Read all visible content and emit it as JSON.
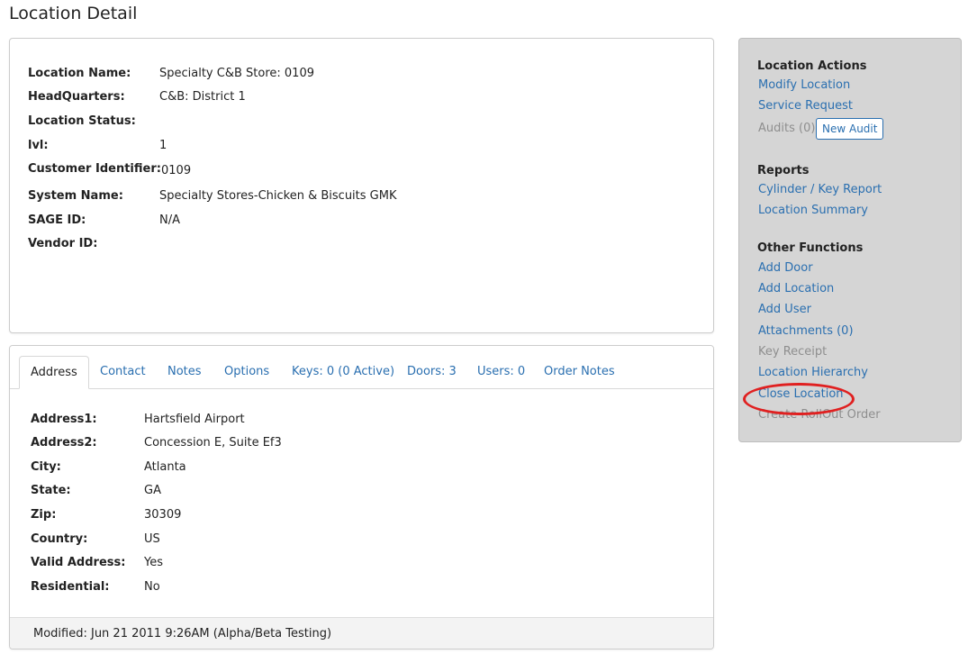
{
  "page": {
    "title": "Location Detail"
  },
  "location_info": [
    {
      "label": "Location Name:",
      "value": "Specialty C&B Store: 0109",
      "is_link": false
    },
    {
      "label": "HeadQuarters:",
      "value": "C&B: District 1",
      "is_link": true
    },
    {
      "label": "Location Status:",
      "value": "",
      "is_link": false
    },
    {
      "label": "lvl:",
      "value": "1",
      "is_link": false
    },
    {
      "label": "Customer Identifier:",
      "value": "0109",
      "is_link": false
    },
    {
      "label": "System Name:",
      "value": "Specialty Stores-Chicken & Biscuits GMK",
      "is_link": false
    },
    {
      "label": "SAGE ID:",
      "value": "N/A",
      "is_link": false
    },
    {
      "label": "Vendor ID:",
      "value": "",
      "is_link": false
    }
  ],
  "tabs": [
    {
      "label": "Address",
      "active": true
    },
    {
      "label": "Contact",
      "active": false
    },
    {
      "label": "Notes",
      "active": false
    },
    {
      "label": "Options",
      "active": false
    },
    {
      "label": "Keys: 0 (0 Active)",
      "active": false
    },
    {
      "label": "Doors: 3",
      "active": false
    },
    {
      "label": "Users: 0",
      "active": false
    },
    {
      "label": "Order Notes",
      "active": false
    }
  ],
  "address": [
    {
      "label": "Address1:",
      "value": "Hartsfield Airport"
    },
    {
      "label": "Address2:",
      "value": "Concession E, Suite Ef3"
    },
    {
      "label": "City:",
      "value": "Atlanta"
    },
    {
      "label": "State:",
      "value": "GA"
    },
    {
      "label": "Zip:",
      "value": "30309"
    },
    {
      "label": "Country:",
      "value": "US"
    },
    {
      "label": "Valid Address:",
      "value": "Yes"
    },
    {
      "label": "Residential:",
      "value": "No"
    }
  ],
  "footer": {
    "modified": "Modified: Jun 21 2011 9:26AM (Alpha/Beta Testing)"
  },
  "actions_panel": {
    "location_actions": {
      "heading": "Location Actions",
      "modify": "Modify Location",
      "service_request": "Service Request",
      "audits": "Audits (0)",
      "new_audit": "New Audit"
    },
    "reports": {
      "heading": "Reports",
      "cylinder_key": "Cylinder / Key Report",
      "location_summary": "Location Summary"
    },
    "other_functions": {
      "heading": "Other Functions",
      "add_door": "Add Door",
      "add_location": "Add Location",
      "add_user": "Add User",
      "attachments": "Attachments (0)",
      "key_receipt": "Key Receipt",
      "location_hierarchy": "Location Hierarchy",
      "close_location": "Close Location",
      "create_rollout": "Create RollOut Order"
    }
  },
  "colors": {
    "link": "#2a6fb0",
    "panel_bg": "#d5d5d5",
    "highlight": "#e02020"
  }
}
